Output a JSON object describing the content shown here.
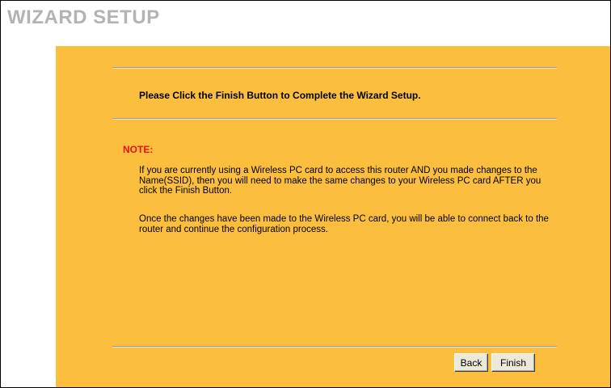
{
  "page": {
    "title": "WIZARD SETUP"
  },
  "content": {
    "heading": "Please Click the Finish Button to Complete the Wizard Setup.",
    "note_label": "NOTE:",
    "paragraphs": [
      "If you are currently using a Wireless PC card to access this router AND you made changes to the Name(SSID), then you will need to make the same changes to your Wireless PC card AFTER you click the Finish Button.",
      "Once the changes have been made to the Wireless PC card, you will be able to connect back to the router and continue the configuration process."
    ]
  },
  "buttons": {
    "back_label": "Back",
    "finish_label": "Finish"
  },
  "colors": {
    "panel": "#fcbe3f",
    "title": "#b3b3b3",
    "note_label": "#e8101a"
  }
}
